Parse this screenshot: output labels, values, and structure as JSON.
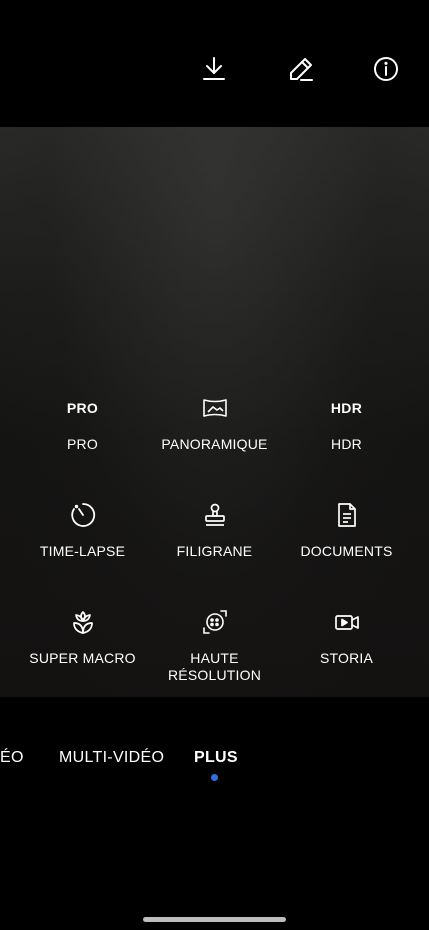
{
  "top_bar": {
    "icons": [
      "download-icon",
      "edit-icon",
      "info-icon"
    ]
  },
  "modes": [
    {
      "label": "PRO",
      "icon_text": "PRO",
      "icon": "pro-icon"
    },
    {
      "label": "PANORAMIQUE",
      "icon": "panorama-icon"
    },
    {
      "label": "HDR",
      "icon_text": "HDR",
      "icon": "hdr-icon"
    },
    {
      "label": "TIME-LAPSE",
      "icon": "timelapse-icon"
    },
    {
      "label": "FILIGRANE",
      "icon": "stamp-icon"
    },
    {
      "label": "DOCUMENTS",
      "icon": "document-icon"
    },
    {
      "label": "SUPER MACRO",
      "icon": "flower-icon"
    },
    {
      "label": "HAUTE\nRÉSOLUTION",
      "icon": "high-res-icon"
    },
    {
      "label": "STORIA",
      "icon": "video-story-icon"
    }
  ],
  "mode_bar": {
    "tabs": [
      {
        "label": "ÉO"
      },
      {
        "label": "MULTI-VIDÉO"
      },
      {
        "label": "PLUS",
        "active": true
      }
    ]
  },
  "colors": {
    "accent": "#2f6fe0",
    "background": "#000000",
    "text": "#ffffff"
  }
}
